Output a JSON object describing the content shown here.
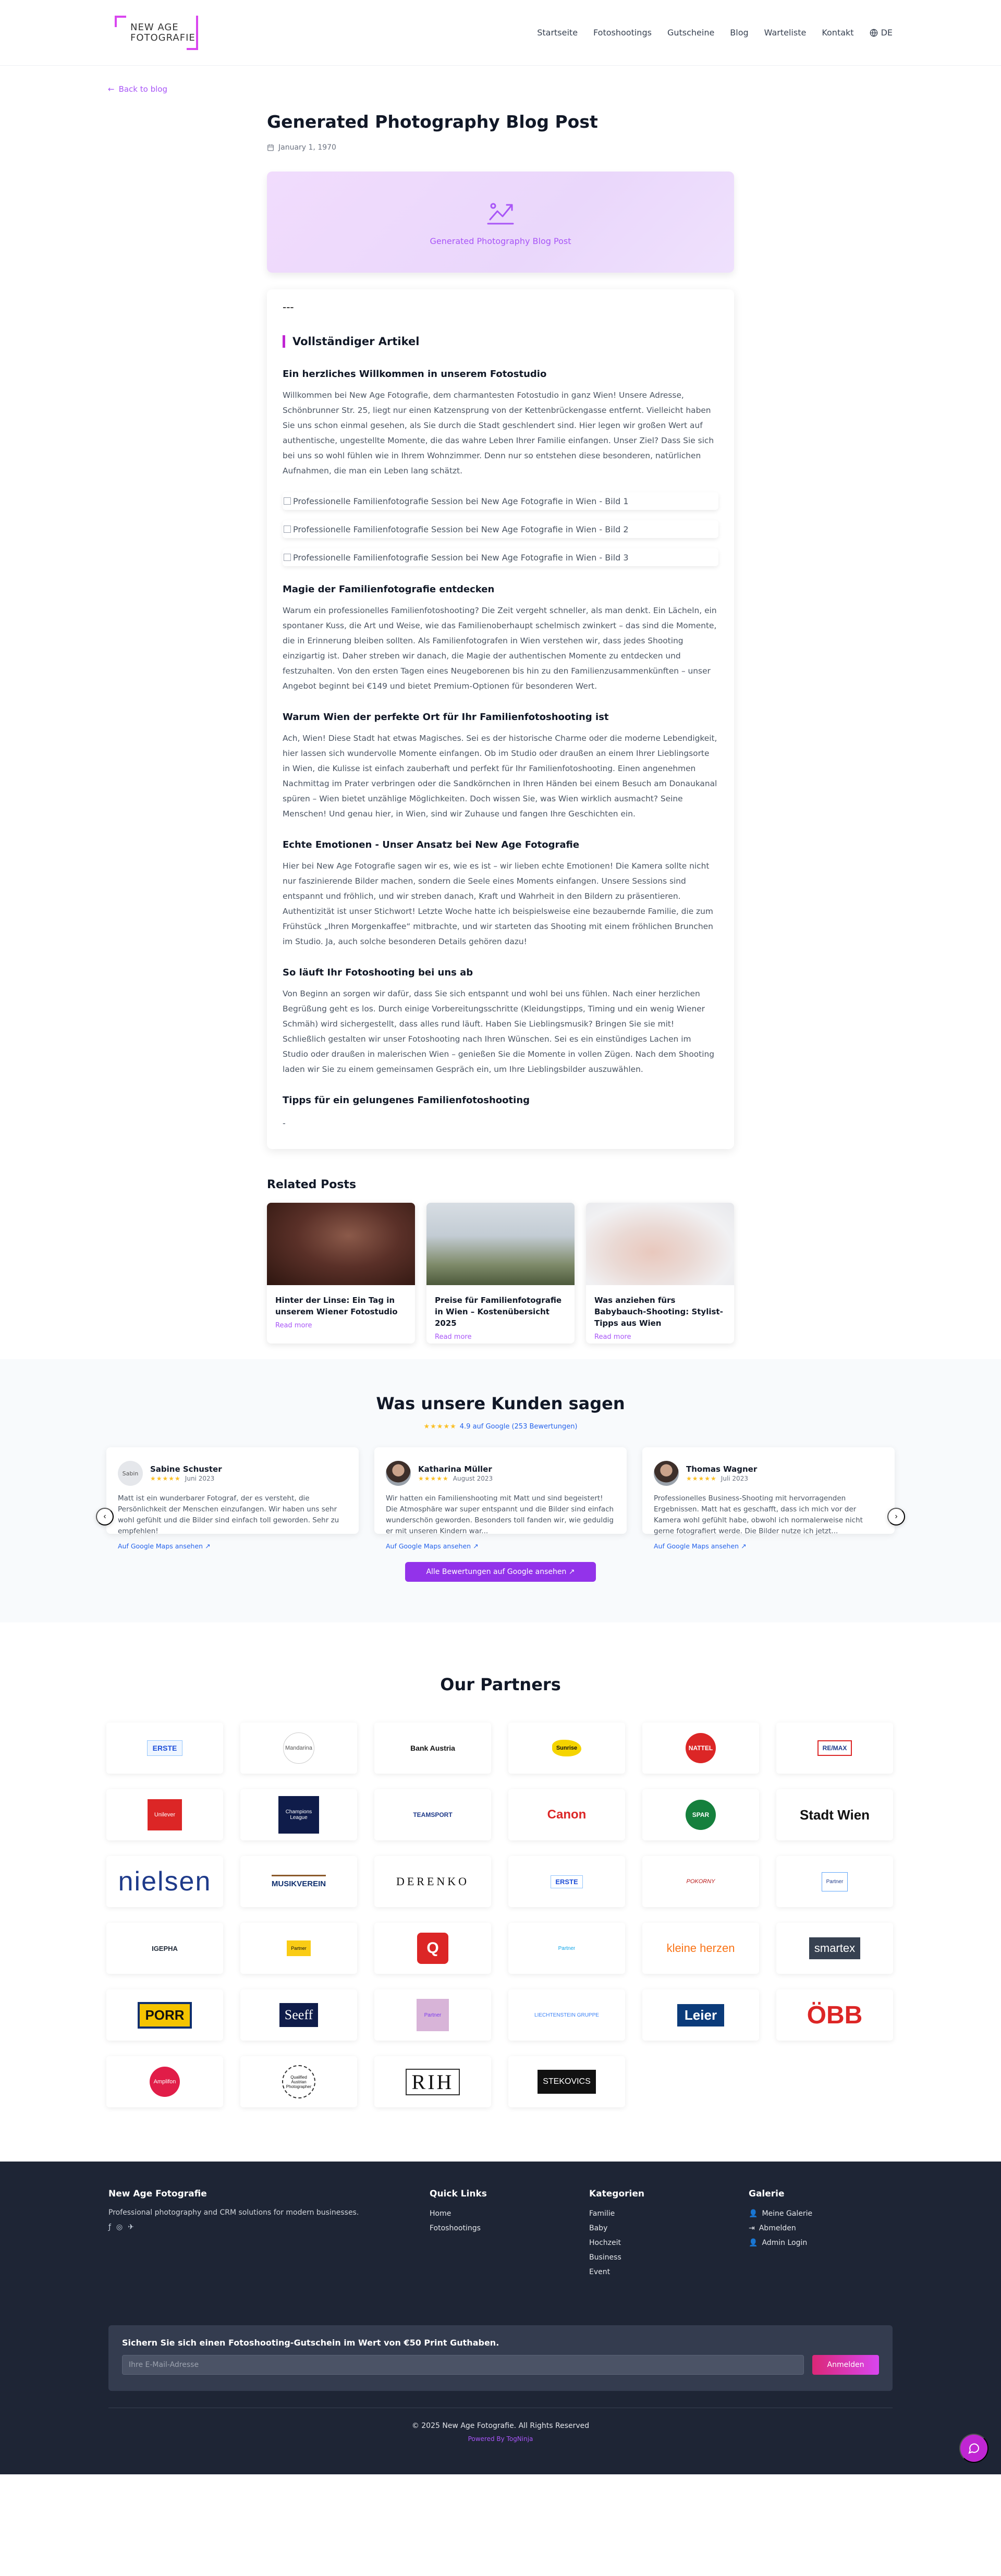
{
  "brand": {
    "line1": "NEW AGE",
    "line2": "FOTOGRAFIE"
  },
  "nav": {
    "items": [
      "Startseite",
      "Fotoshootings",
      "Gutscheine",
      "Blog",
      "Warteliste",
      "Kontakt"
    ],
    "language": "DE"
  },
  "back_link": "Back to blog",
  "post": {
    "title": "Generated Photography Blog Post",
    "date": "January 1, 1970",
    "hero_caption": "Generated Photography Blog Post",
    "dashes": "---",
    "section_title": "Vollständiger Artikel",
    "intro_heading": "Ein herzliches Willkommen in unserem Fotostudio",
    "intro_text": "Willkommen bei New Age Fotografie, dem charmantesten Fotostudio in ganz Wien! Unsere Adresse, Schönbrunner Str. 25, liegt nur einen Katzensprung von der Kettenbrückengasse entfernt. Vielleicht haben Sie uns schon einmal gesehen, als Sie durch die Stadt geschlendert sind. Hier legen wir großen Wert auf authentische, ungestellte Momente, die das wahre Leben Ihrer Familie einfangen. Unser Ziel? Dass Sie sich bei uns so wohl fühlen wie in Ihrem Wohnzimmer. Denn nur so entstehen diese besonderen, natürlichen Aufnahmen, die man ein Leben lang schätzt.",
    "image_alts": [
      "Professionelle Familienfotografie Session bei New Age Fotografie in Wien - Bild 1",
      "Professionelle Familienfotografie Session bei New Age Fotografie in Wien - Bild 2",
      "Professionelle Familienfotografie Session bei New Age Fotografie in Wien - Bild 3"
    ],
    "sections": [
      {
        "heading": "Magie der Familienfotografie entdecken",
        "text": "Warum ein professionelles Familienfotoshooting? Die Zeit vergeht schneller, als man denkt. Ein Lächeln, ein spontaner Kuss, die Art und Weise, wie das Familienoberhaupt schelmisch zwinkert – das sind die Momente, die in Erinnerung bleiben sollten. Als Familienfotografen in Wien verstehen wir, dass jedes Shooting einzigartig ist. Daher streben wir danach, die Magie der authentischen Momente zu entdecken und festzuhalten. Von den ersten Tagen eines Neugeborenen bis hin zu den Familienzusammenkünften – unser Angebot beginnt bei €149 und bietet Premium-Optionen für besonderen Wert."
      },
      {
        "heading": "Warum Wien der perfekte Ort für Ihr Familienfotoshooting ist",
        "text": "Ach, Wien! Diese Stadt hat etwas Magisches. Sei es der historische Charme oder die moderne Lebendigkeit, hier lassen sich wundervolle Momente einfangen. Ob im Studio oder draußen an einem Ihrer Lieblingsorte in Wien, die Kulisse ist einfach zauberhaft und perfekt für Ihr Familienfotoshooting. Einen angenehmen Nachmittag im Prater verbringen oder die Sandkörnchen in Ihren Händen bei einem Besuch am Donaukanal spüren – Wien bietet unzählige Möglichkeiten. Doch wissen Sie, was Wien wirklich ausmacht? Seine Menschen! Und genau hier, in Wien, sind wir Zuhause und fangen Ihre Geschichten ein."
      },
      {
        "heading": "Echte Emotionen - Unser Ansatz bei New Age Fotografie",
        "text": "Hier bei New Age Fotografie sagen wir es, wie es ist – wir lieben echte Emotionen! Die Kamera sollte nicht nur faszinierende Bilder machen, sondern die Seele eines Moments einfangen. Unsere Sessions sind entspannt und fröhlich, und wir streben danach, Kraft und Wahrheit in den Bildern zu präsentieren. Authentizität ist unser Stichwort! Letzte Woche hatte ich beispielsweise eine bezaubernde Familie, die zum Frühstück „Ihren Morgenkaffee“ mitbrachte, und wir starteten das Shooting mit einem fröhlichen Brunchen im Studio. Ja, auch solche besonderen Details gehören dazu!"
      },
      {
        "heading": "So läuft Ihr Fotoshooting bei uns ab",
        "text": "Von Beginn an sorgen wir dafür, dass Sie sich entspannt und wohl bei uns fühlen. Nach einer herzlichen Begrüßung geht es los. Durch einige Vorbereitungsschritte (Kleidungstipps, Timing und ein wenig Wiener Schmäh) wird sichergestellt, dass alles rund läuft. Haben Sie Lieblingsmusik? Bringen Sie sie mit! Schließlich gestalten wir unser Fotoshooting nach Ihren Wünschen. Sei es ein einstündiges Lachen im Studio oder draußen in malerischen Wien – genießen Sie die Momente in vollen Zügen. Nach dem Shooting laden wir Sie zu einem gemeinsamen Gespräch ein, um Ihre Lieblingsbilder auszuwählen."
      }
    ],
    "tips_heading": "Tipps für ein gelungenes Familienfotoshooting",
    "tail": "-"
  },
  "related": {
    "title": "Related Posts",
    "read_more": "Read more",
    "posts": [
      {
        "title": "Hinter der Linse: Ein Tag in unserem Wiener Fotostudio"
      },
      {
        "title": "Preise für Familienfotografie in Wien – Kostenübersicht 2025"
      },
      {
        "title": "Was anziehen fürs Babybauch-Shooting: Stylist-Tipps aus Wien"
      }
    ]
  },
  "reviews": {
    "title": "Was unsere Kunden sagen",
    "rating_text": "4.9 auf Google (253 Bewertungen)",
    "stars": "★★★★★",
    "link_label": "Auf Google Maps ansehen",
    "all_button": "Alle Bewertungen auf Google ansehen",
    "items": [
      {
        "avatar_text": "Sabin",
        "name": "Sabine Schuster",
        "date": "Juni 2023",
        "text": "Matt ist ein wunderbarer Fotograf, der es versteht, die Persönlichkeit der Menschen einzufangen. Wir haben uns sehr wohl gefühlt und die Bilder sind einfach toll geworden. Sehr zu empfehlen!"
      },
      {
        "avatar_text": "",
        "name": "Katharina Müller",
        "date": "August 2023",
        "text": "Wir hatten ein Familienshooting mit Matt und sind begeistert! Die Atmosphäre war super entspannt und die Bilder sind einfach wunderschön geworden. Besonders toll fanden wir, wie geduldig er mit unseren Kindern war..."
      },
      {
        "avatar_text": "",
        "name": "Thomas Wagner",
        "date": "Juli 2023",
        "text": "Professionelles Business-Shooting mit hervorragenden Ergebnissen. Matt hat es geschafft, dass ich mich vor der Kamera wohl gefühlt habe, obwohl ich normalerweise nicht gerne fotografiert werde. Die Bilder nutze ich jetzt..."
      }
    ]
  },
  "partners": {
    "title": "Our Partners",
    "logos": [
      "ERSTE",
      "Mandarina",
      "Bank Austria",
      "Sunrise",
      "NATTEL",
      "RE/MAX",
      "Unilever",
      "Champions League",
      "TEAMSPORT",
      "Canon",
      "SPAR",
      "Stadt Wien",
      "nielsen",
      "MUSIKVEREIN",
      "DERENKO",
      "ERSTE",
      "POKORNY",
      "Partner",
      "IGEPHA",
      "Partner",
      "Q",
      "Partner",
      "kleine herzen",
      "smartex",
      "PORR",
      "Seeff",
      "Partner",
      "LIECHTENSTEIN GRUPPE",
      "Leier",
      "ÖBB",
      "Amplifon",
      "Qualified Austrian Photographer",
      "RIH",
      "STEKOVICS"
    ]
  },
  "footer": {
    "brand_title": "New Age Fotografie",
    "brand_text": "Professional photography and CRM solutions for modern businesses.",
    "quick_title": "Quick Links",
    "quick_links": [
      "Home",
      "Fotoshootings"
    ],
    "cat_title": "Kategorien",
    "categories": [
      "Familie",
      "Baby",
      "Hochzeit",
      "Business",
      "Event"
    ],
    "gallery_title": "Galerie",
    "gallery_links": [
      "Meine Galerie",
      "Abmelden",
      "Admin Login"
    ],
    "newsletter_title": "Sichern Sie sich einen Fotoshooting-Gutschein im Wert von €50 Print Guthaben.",
    "newsletter_placeholder": "Ihre E-Mail-Adresse",
    "newsletter_button": "Anmelden",
    "copyright": "© 2025 New Age Fotografie. All Rights Reserved",
    "powered": "Powered By TogNinja"
  },
  "colors": {
    "accent": "#a855f7",
    "brand_pink": "#d946ef",
    "footer_bg": "#1e2535",
    "review_link": "#2563eb",
    "stars": "#fbbf24"
  }
}
